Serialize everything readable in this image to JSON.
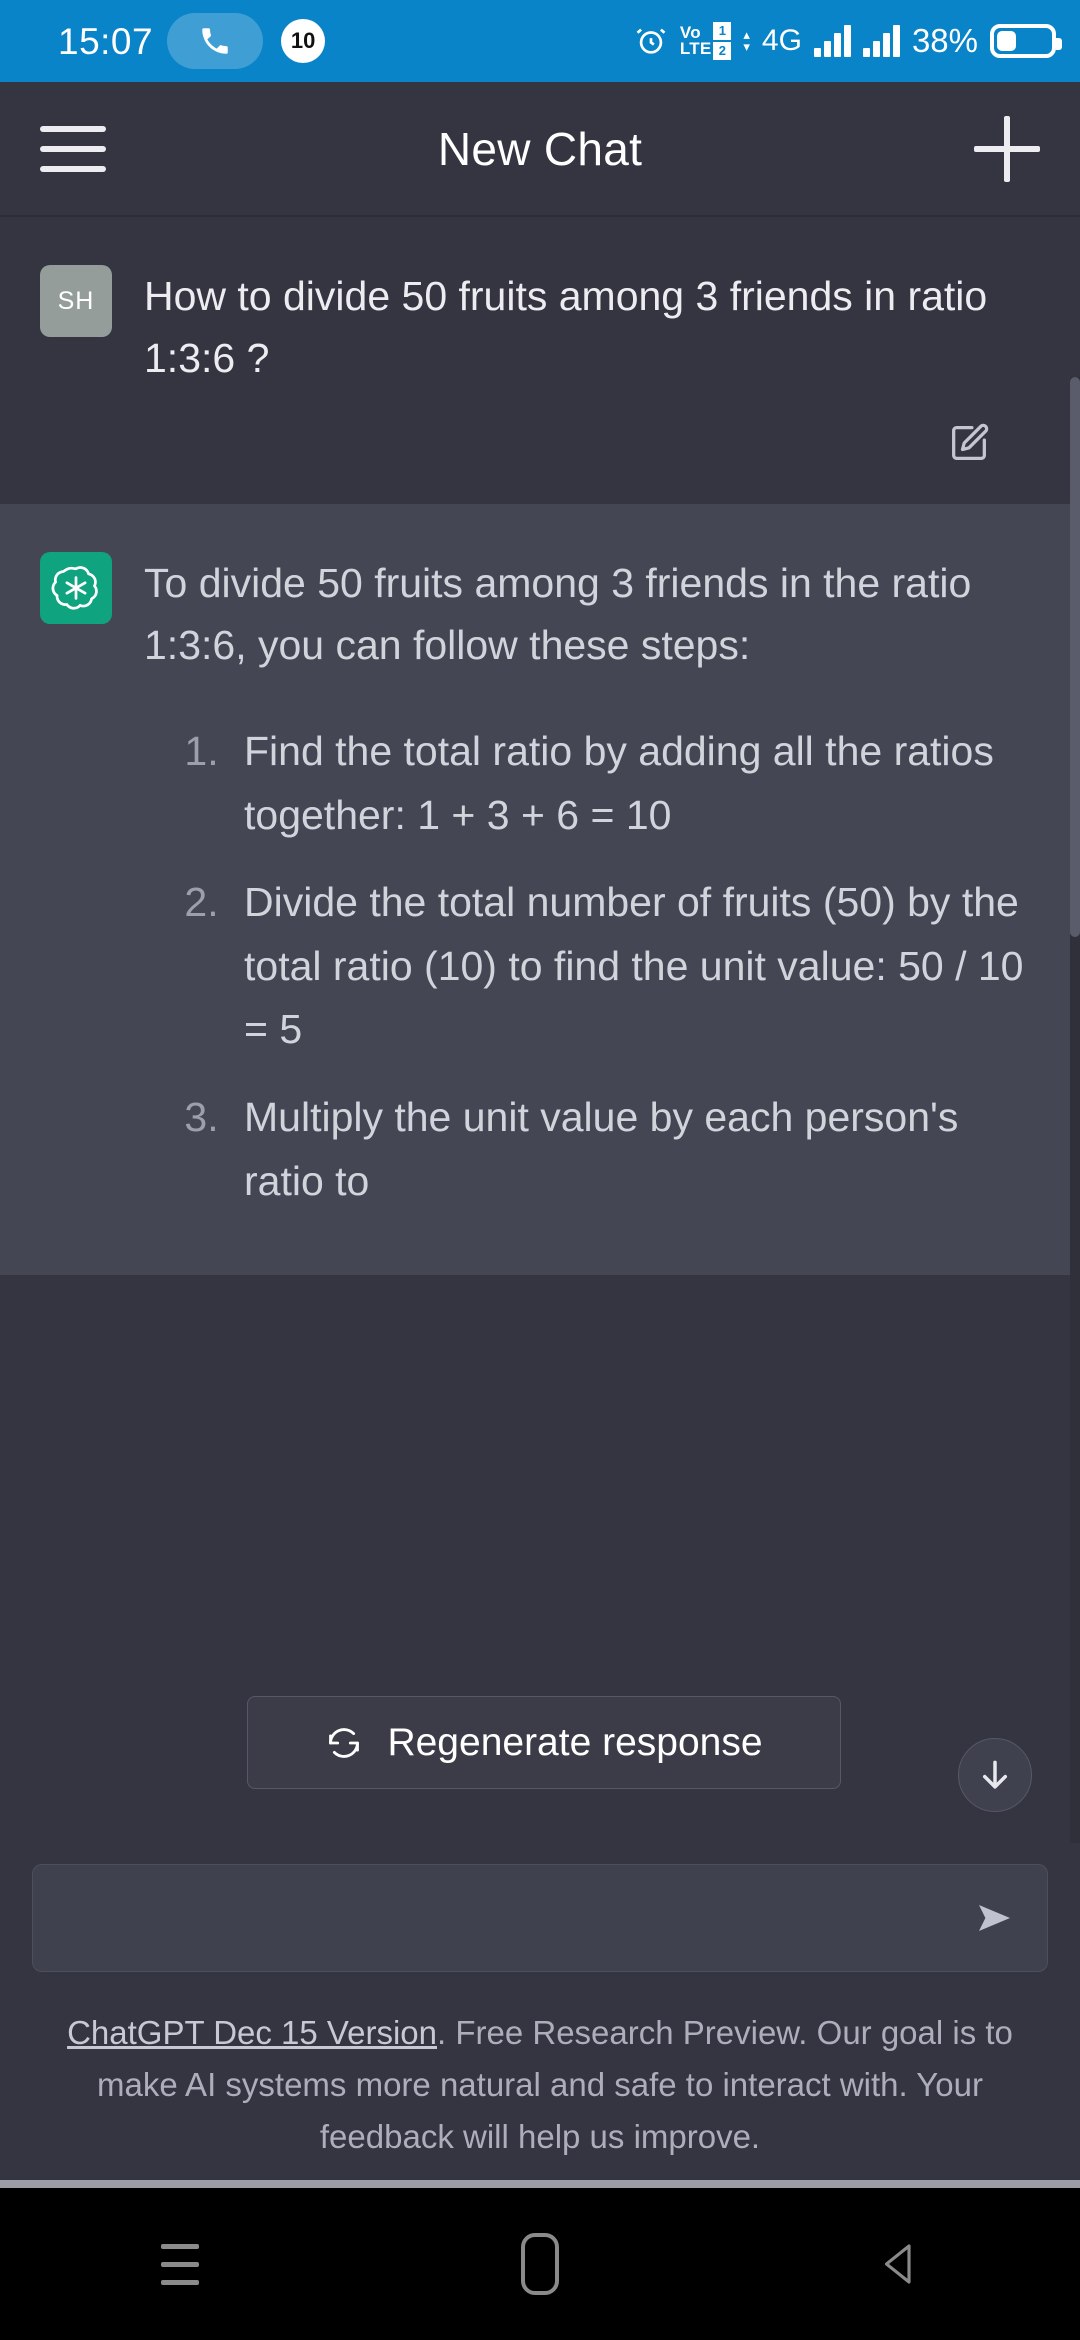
{
  "statusbar": {
    "time": "15:07",
    "call_badge": "10",
    "volte_label_top": "Vo",
    "volte_label_bottom": "LTE",
    "sim1": "1",
    "sim2": "2",
    "network": "4G",
    "battery_percent": "38%",
    "icons": [
      "phone-icon",
      "alarm-clock-icon",
      "volte-icon",
      "data-arrows-icon",
      "signal-bars-icon",
      "signal-bars-2-icon",
      "battery-icon"
    ]
  },
  "header": {
    "title": "New Chat",
    "menu_icon": "hamburger-menu-icon",
    "new_chat_icon": "plus-icon"
  },
  "messages": [
    {
      "role": "user",
      "avatar_initials": "SH",
      "text": "How to divide 50 fruits among 3 friends in ratio 1:3:6 ?",
      "edit_icon": "edit-pencil-square-icon"
    },
    {
      "role": "assistant",
      "avatar_icon": "openai-logo-icon",
      "intro": "To divide 50 fruits among 3 friends in the ratio 1:3:6, you can follow these steps:",
      "steps": [
        "Find the total ratio by adding all the ratios together: 1 + 3 + 6 = 10",
        "Divide the total number of fruits (50) by the total ratio (10) to find the unit value: 50 / 10 = 5",
        "Multiply the unit value by each person's ratio to"
      ]
    }
  ],
  "controls": {
    "regenerate_label": "Regenerate response",
    "regenerate_icon": "refresh-icon",
    "scroll_down_icon": "arrow-down-icon"
  },
  "composer": {
    "input_value": "",
    "placeholder": "",
    "send_icon": "send-arrow-icon"
  },
  "footer": {
    "link_text": "ChatGPT Dec 15 Version",
    "rest_text": ". Free Research Preview. Our goal is to make AI systems more natural and safe to interact with. Your feedback will help us improve."
  },
  "navbar": {
    "recents_icon": "recents-icon",
    "home_icon": "home-icon",
    "back_icon": "back-icon"
  },
  "colors": {
    "status_bar": "#0a84c8",
    "user_bg": "#343541",
    "assistant_bg": "#444654",
    "brand_green": "#10a37f",
    "text_primary": "#ececf1"
  }
}
